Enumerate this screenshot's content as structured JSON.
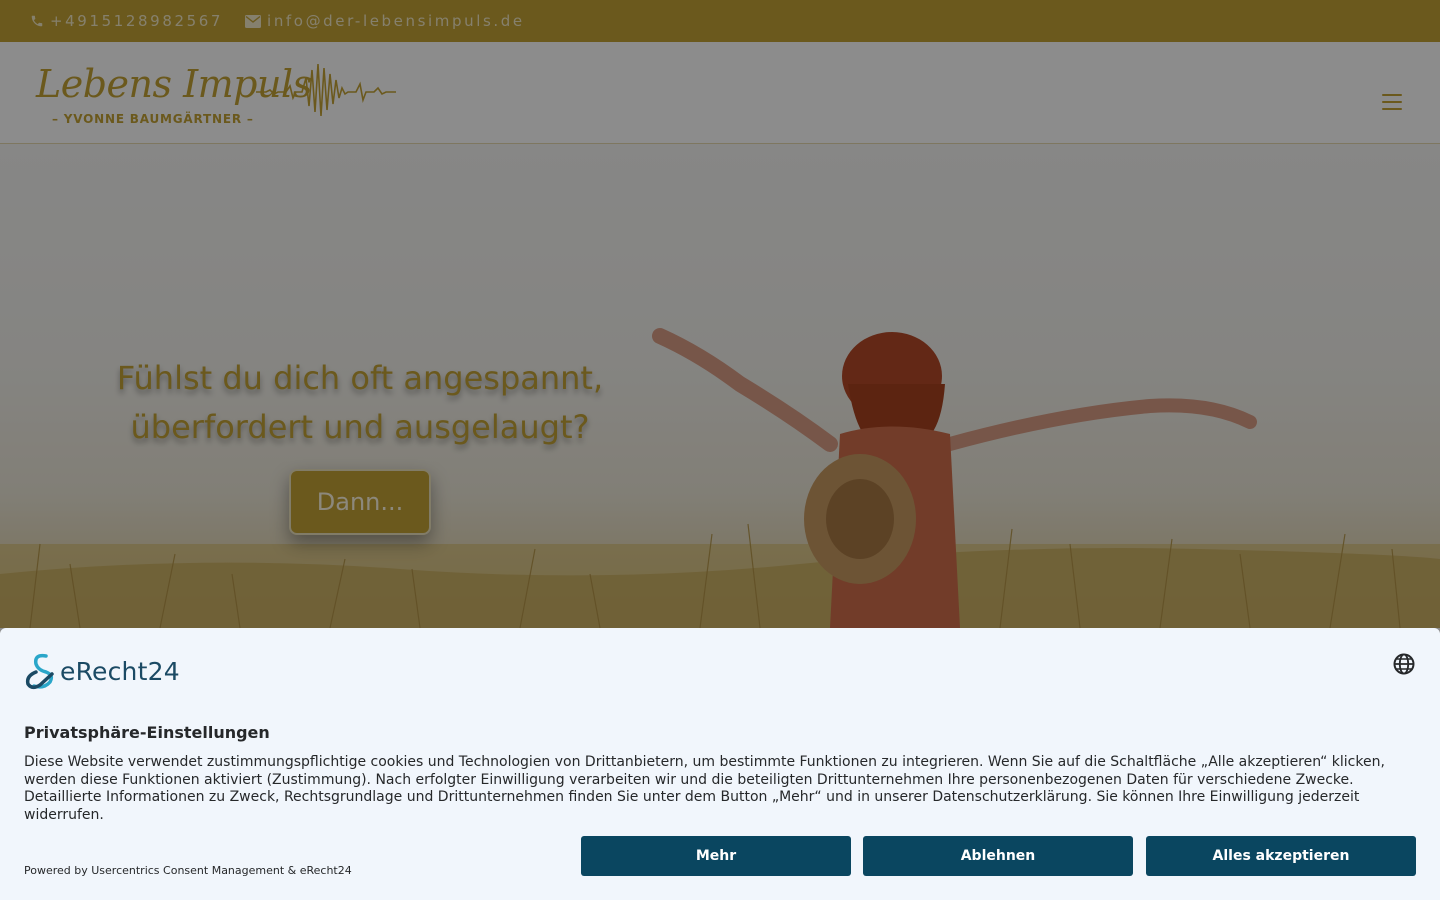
{
  "topbar": {
    "phone": "+4915128982567",
    "email": "info@der-lebensimpuls.de",
    "icons": [
      "phone-icon",
      "envelope-icon"
    ]
  },
  "header": {
    "logo_script": "Lebens Impuls",
    "logo_sub": "– YVONNE BAUMGÄRTNER –",
    "menu_icon": "hamburger-menu-icon"
  },
  "hero": {
    "headline_line1": "Fühlst du dich oft angespannt,",
    "headline_line2": "überfordert und ausgelaugt?",
    "cta_label": "Dann..."
  },
  "consent": {
    "brand": "eRecht24",
    "title": "Privatsphäre-Einstellungen",
    "text": "Diese Website verwendet zustimmungspflichtige cookies und Technologien von Drittanbietern, um bestimmte Funktionen zu integrieren. Wenn Sie auf die Schaltfläche „Alle akzeptieren“ klicken, werden diese Funktionen aktiviert (Zustimmung). Nach erfolgter Einwilligung verarbeiten wir und die beteiligten Drittunternehmen Ihre personenbezogenen Daten für verschiedene Zwecke. Detaillierte Informationen zu Zweck, Rechtsgrundlage und Drittunternehmen finden Sie unter dem Button „Mehr“ und in unserer Datenschutzerklärung. Sie können Ihre Einwilligung jederzeit widerrufen.",
    "powered_by": "Powered by Usercentrics Consent Management & eRecht24",
    "buttons": {
      "more": "Mehr",
      "deny": "Ablehnen",
      "accept_all": "Alles akzeptieren"
    },
    "language_icon": "globe-icon"
  },
  "colors": {
    "gold": "#c4a235",
    "consent_bg": "#f1f6fc",
    "button_bg": "#0a4660"
  }
}
